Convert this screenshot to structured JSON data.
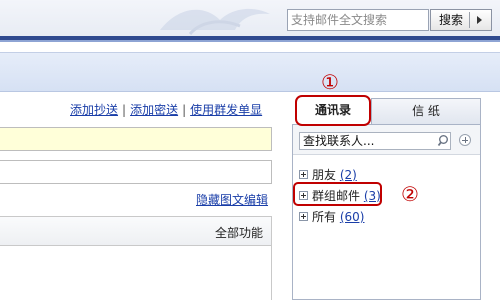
{
  "header": {
    "search_placeholder": "支持邮件全文搜索",
    "search_button": "搜索"
  },
  "compose": {
    "links": [
      "添加抄送",
      "添加密送",
      "使用群发单显"
    ],
    "hide_editor": "隐藏图文编辑",
    "editor_menu": "全部功能"
  },
  "sidebar": {
    "tabs": [
      "通讯录",
      "信 纸"
    ],
    "search_value": "查找联系人...",
    "groups": [
      {
        "name": "朋友",
        "count": "(2)"
      },
      {
        "name": "群组邮件",
        "count": "(3)"
      },
      {
        "name": "所有",
        "count": "(60)"
      }
    ]
  },
  "annotations": [
    "①",
    "②"
  ],
  "colors": {
    "highlight": "#c00000",
    "link": "#1a3ea8",
    "accent_bar": "#2f4a8f"
  }
}
